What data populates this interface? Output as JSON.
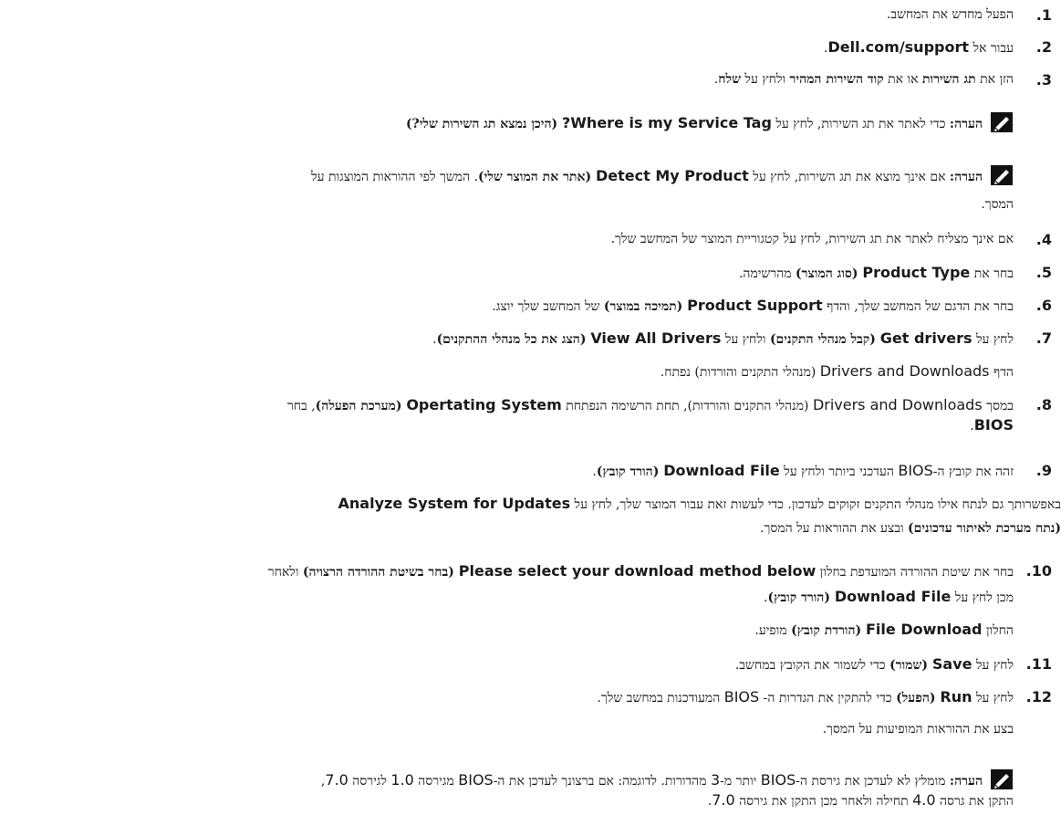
{
  "steps": [
    {
      "num": ".1",
      "text": "הפעל מחדש את המחשב."
    },
    {
      "num": ".2",
      "a": "עבור אל ",
      "b": "Dell.com/support",
      "c": "."
    },
    {
      "num": ".3",
      "a": "הזן את ",
      "b": "תג השירות",
      "c": " או את ",
      "d": "קוד השירות המהיר",
      "e": " ולחץ על ",
      "f": "שלח",
      "g": "."
    },
    {
      "num": ".4",
      "text": "אם אינך מצליח לאתר את תג השירות, לחץ על קטגוריית המוצר של המחשב שלך."
    },
    {
      "num": ".5",
      "a": "בחר את ",
      "b": "Product Type",
      "c": " (סוג המוצר)",
      "d": " מהרשימה."
    },
    {
      "num": ".6",
      "a": "בחר את הדגם של המחשב שלך, והדף ",
      "b": "Product Support",
      "c": " (תמיכה במוצר)",
      "d": " של המחשב שלך יוצג."
    },
    {
      "num": ".7",
      "a": "לחץ על ",
      "b": "Get drivers",
      "c": " (קבל מנהלי התקנים)",
      "d": " ולחץ על ",
      "e": "View All Drivers",
      "f": " (הצג את כל מנהלי ההתקנים)",
      "g": "."
    },
    {
      "num": ".8",
      "a": "במסך ",
      "b": "Drivers and Downloads",
      "c": " (מנהלי התקנים והורדות), תחת הרשימה הנפתחת ",
      "d": "Opertating System",
      "e": " (מערכת הפעלה)",
      "f": ", בחר",
      "g": "BIOS",
      "h": "."
    },
    {
      "num": ".9",
      "a": "זהה את קובץ ה-",
      "b": "BIOS",
      "c": " העדכני ביותר ולחץ על ",
      "d": "Download File",
      "e": " (הורד קובץ)",
      "f": "."
    },
    {
      "num": ".10",
      "a": "בחר את שיטת ההורדה המועדפת בחלון ",
      "b": "Please select your download method below",
      "c": " (בחר בשיטת ההורדה הרצויה)",
      "d": " ולאחר",
      "e": "מכן לחץ על ",
      "f": "Download File",
      "g": " (הורד קובץ)",
      "h": "."
    },
    {
      "num": ".11",
      "a": "לחץ על ",
      "b": "Save",
      "c": " (שמור)",
      "d": " כדי לשמור את הקובץ במחשב."
    },
    {
      "num": ".12",
      "a": "לחץ על ",
      "b": "Run",
      "c": " (הפעל)",
      "d": " כדי להתקין את הגדרות ה- ",
      "e": "BIOS",
      "f": " המעודכנות במחשב שלך."
    }
  ],
  "notes": [
    {
      "label": "הערה:",
      "a": " כדי לאתר את תג השירות, לחץ על ",
      "b": "Where is my Service Tag?",
      "c": " (היכן נמצא תג השירות שלי?)"
    },
    {
      "label": "הערה:",
      "a": " אם אינך מוצא את תג השירות, לחץ על ",
      "b": "Detect My Product",
      "c": " (אתר את המוצר שלי)",
      "d": ". המשך לפי ההוראות המוצגות על",
      "e": "המסך."
    }
  ],
  "sub": {
    "s7": {
      "a": "הדף ",
      "b": "Drivers and Downloads",
      "c": " (מנהלי התקנים והורדות) נפתח."
    },
    "s9": {
      "a": "באפשרותך גם לנתח אילו מנהלי התקנים זקוקים לעדכון. כדי לעשות זאת עבור המוצר שלך, לחץ על ",
      "b": "Analyze System for Updates",
      "c": "(נתח מערכת לאיתור עדכונים)",
      "d": " ובצע את ההוראות על המסך."
    },
    "s10": {
      "a": "החלון ",
      "b": "File Download",
      "c": " (הורדת קובץ)",
      "d": " מופיע."
    },
    "s12": {
      "text": "בצע את ההוראות המופיעות על המסך."
    }
  },
  "footer_note": {
    "label": "הערה:",
    "a": " מומלץ לא לעדכן את גירסת ה-",
    "b": "BIOS",
    "c": " יותר מ-",
    "d": "3",
    "e": " מהדורות. לדוגמה: אם ברצונך לעדכן את ה-",
    "f": "BIOS",
    "g": " מגירסה ",
    "h": "1.0",
    "i": " לגירסה ",
    "j": "7.0",
    "k": ",",
    "l": "התקן את גרסה ",
    "m": "4.0",
    "n": " תחילה ולאחר מכן התקן את גירסה ",
    "o": "7.0",
    "p": "."
  },
  "icon": "note-pencil-icon"
}
